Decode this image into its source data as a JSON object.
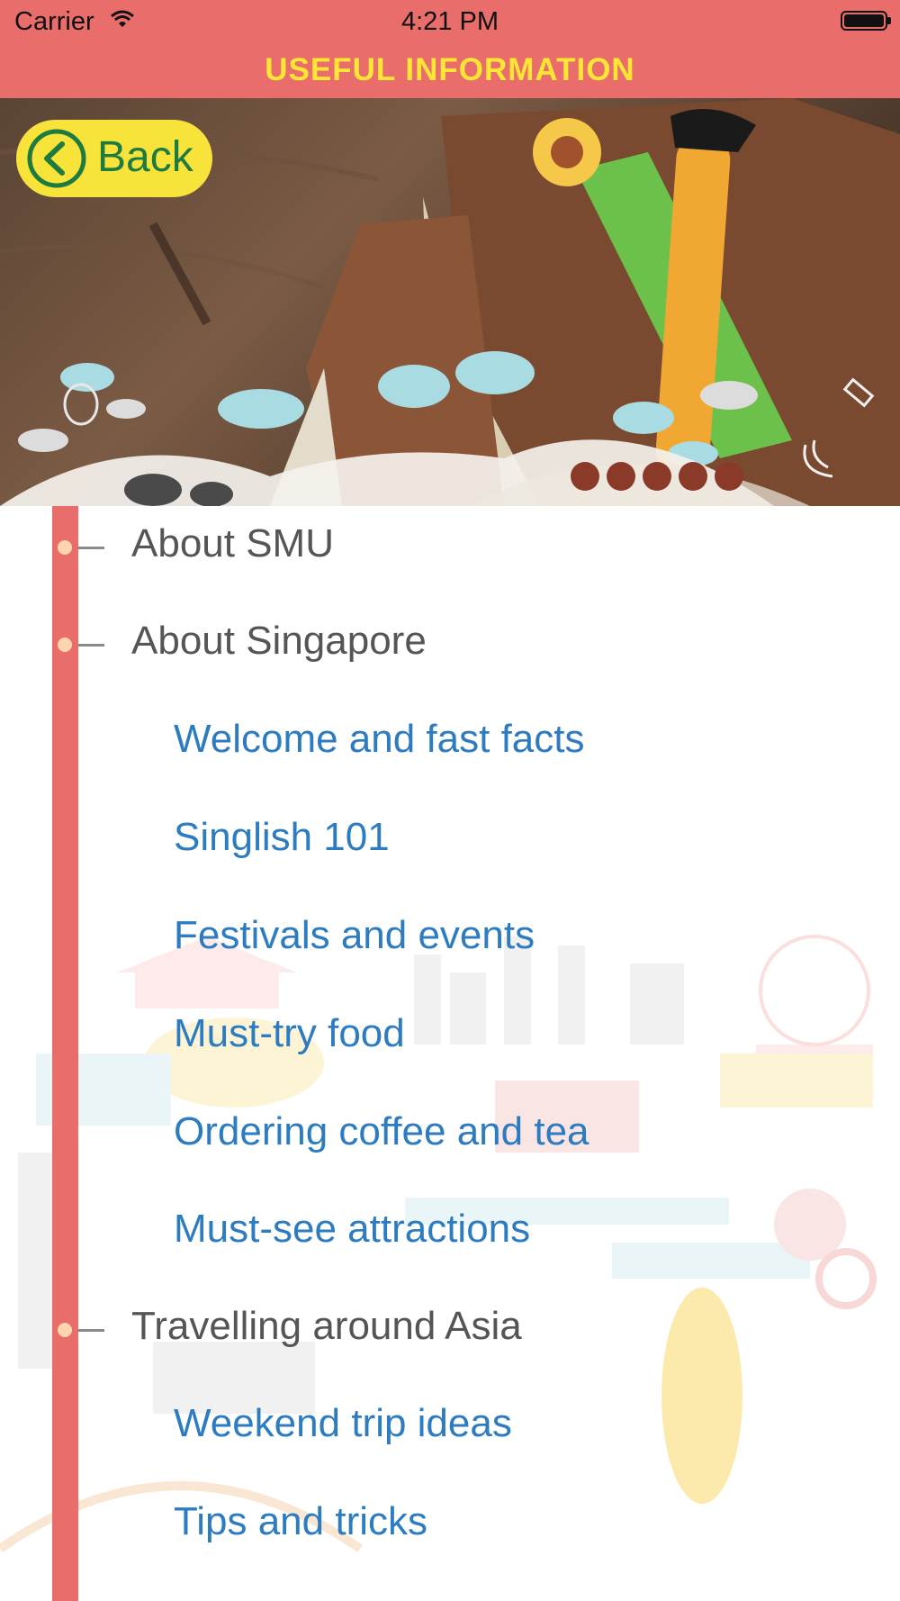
{
  "status_bar": {
    "carrier": "Carrier",
    "time": "4:21 PM",
    "battery_level": 1.0
  },
  "nav": {
    "title": "USEFUL INFORMATION"
  },
  "header": {
    "back_label": "Back"
  },
  "menu": {
    "items": [
      {
        "label": "About SMU",
        "kind": "section"
      },
      {
        "label": "About Singapore",
        "kind": "section"
      },
      {
        "label": "Welcome and fast facts",
        "kind": "sub"
      },
      {
        "label": "Singlish 101",
        "kind": "sub"
      },
      {
        "label": "Festivals and events",
        "kind": "sub"
      },
      {
        "label": "Must-try food",
        "kind": "sub"
      },
      {
        "label": "Ordering coffee and tea",
        "kind": "sub"
      },
      {
        "label": "Must-see attractions",
        "kind": "sub"
      },
      {
        "label": "Travelling around Asia",
        "kind": "section"
      },
      {
        "label": "Weekend trip ideas",
        "kind": "sub"
      },
      {
        "label": "Tips and tricks",
        "kind": "sub"
      }
    ]
  },
  "colors": {
    "accent": "#e96d6b",
    "title": "#ffe534",
    "link": "#2d7cc2",
    "section": "#555555",
    "back_button": "#f7e33a",
    "back_text": "#1e7b40"
  }
}
